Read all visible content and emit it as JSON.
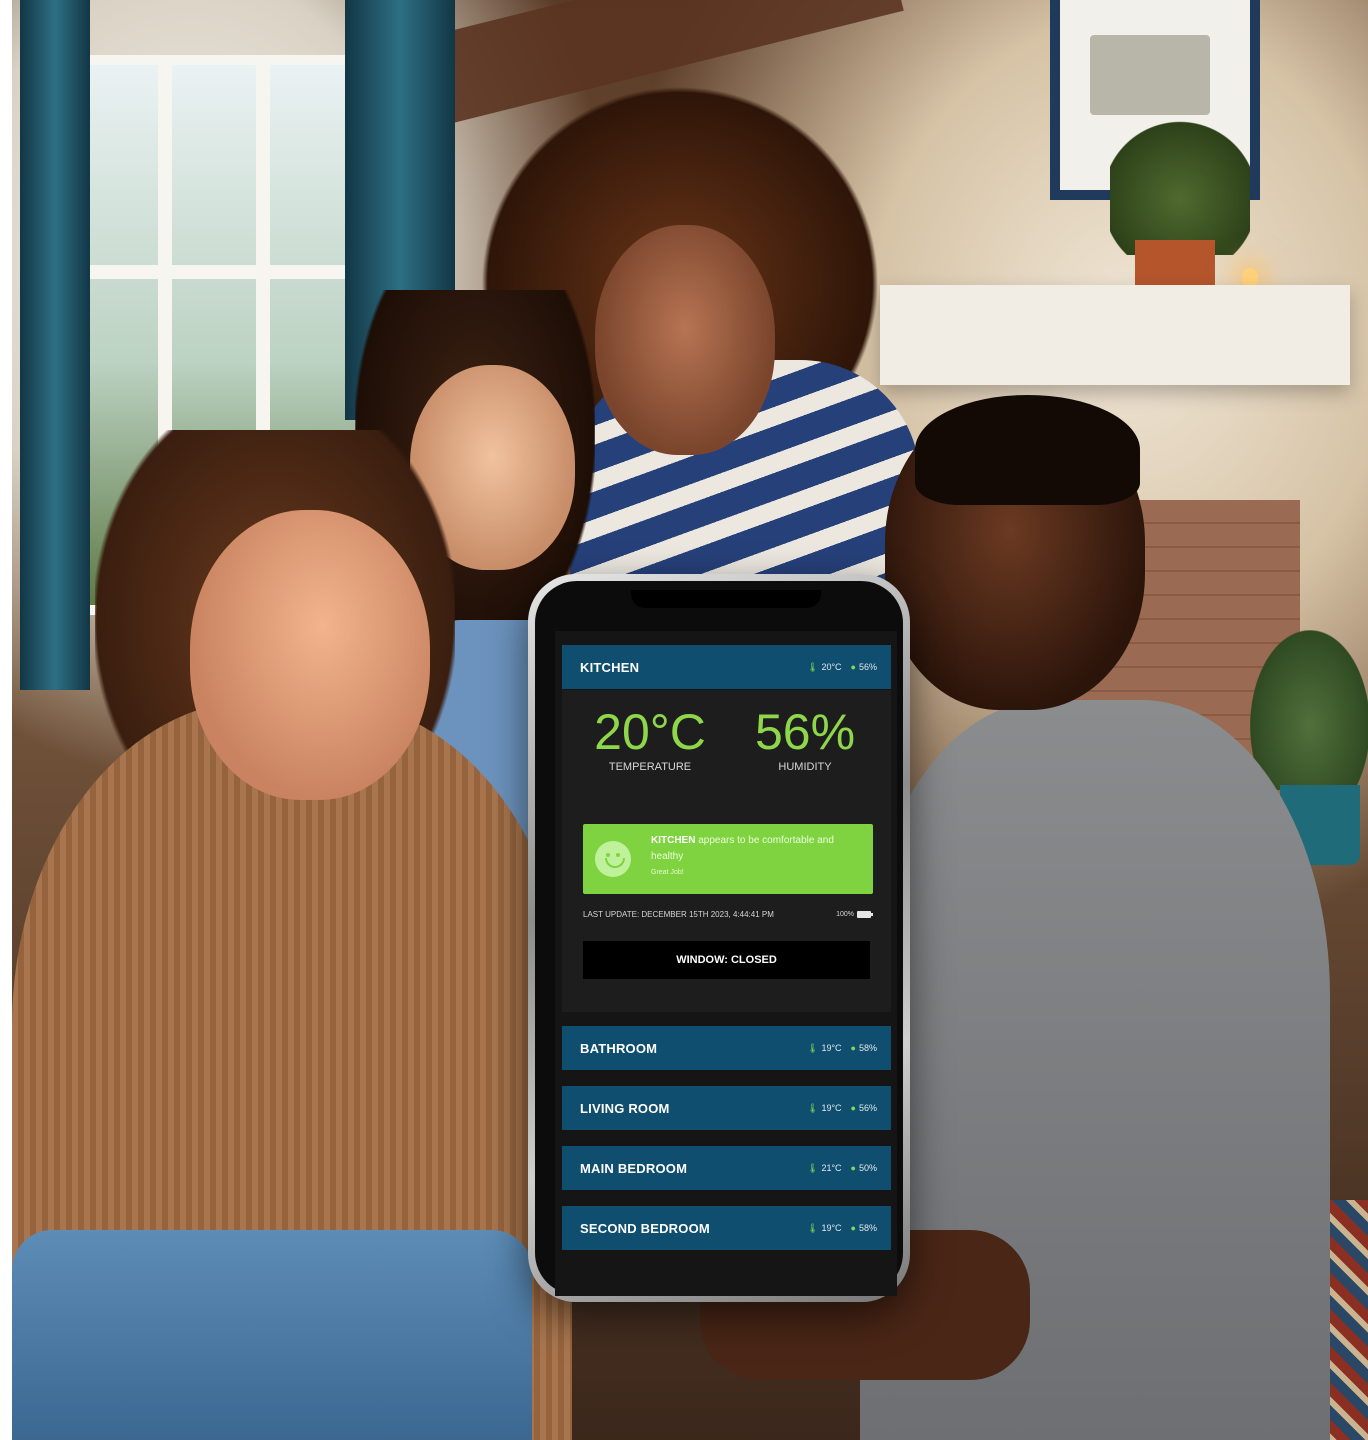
{
  "app": {
    "active_room": {
      "name": "KITCHEN",
      "header_temperature": "20°C",
      "header_humidity": "56%",
      "temperature_value": "20°C",
      "temperature_label": "TEMPERATURE",
      "humidity_value": "56%",
      "humidity_label": "HUMIDITY",
      "comfort": {
        "room": "KITCHEN",
        "message": "appears to be comfortable and healthy",
        "sub": "Great Job!"
      },
      "last_update": "LAST UPDATE: DECEMBER 15TH 2023, 4:44:41 PM",
      "battery": "100%",
      "window_status": "WINDOW: CLOSED"
    },
    "rooms": [
      {
        "name": "BATHROOM",
        "temperature": "19°C",
        "humidity": "58%"
      },
      {
        "name": "LIVING ROOM",
        "temperature": "19°C",
        "humidity": "56%"
      },
      {
        "name": "MAIN BEDROOM",
        "temperature": "21°C",
        "humidity": "50%"
      },
      {
        "name": "SECOND BEDROOM",
        "temperature": "19°C",
        "humidity": "58%"
      }
    ]
  },
  "colors": {
    "header_bg": "#0f4e6e",
    "accent_green": "#7fd340",
    "reading_green": "#8ed64a",
    "screen_bg": "#151515"
  },
  "icons": {
    "temperature": "thermometer-icon",
    "humidity": "droplet-icon",
    "comfort": "smiley-face-icon",
    "battery": "battery-icon"
  }
}
